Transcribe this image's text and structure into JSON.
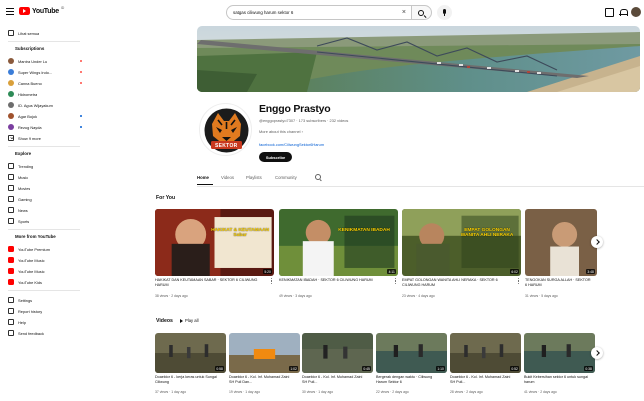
{
  "topbar": {
    "logo_text": "YouTube",
    "logo_country": "ID",
    "search_value": "satgas ciliwung harum sektor 6"
  },
  "sidebar": {
    "top_items": [
      {
        "label": "Lihat semua",
        "icon": "chevron-down-icon"
      }
    ],
    "subscriptions_heading": "Subscriptions",
    "subscriptions": [
      {
        "label": "Mantra Under Lu",
        "live": true,
        "color": "#8a5a3c"
      },
      {
        "label": "Super Wings Indo...",
        "live": true,
        "color": "#3b7dd8"
      },
      {
        "label": "Canna Bueno",
        "live": true,
        "color": "#d9a03b"
      },
      {
        "label": "Hidrometra",
        "live": false,
        "color": "#2e8b57"
      },
      {
        "label": "ID. Agus Wijayakum",
        "live": false,
        "color": "#6d6d6d"
      },
      {
        "label": "Agar Bojok",
        "live": false,
        "color": "#a0522d",
        "dot": true
      },
      {
        "label": "Rezug Nayda",
        "live": false,
        "color": "#7b3fa0",
        "dot": true
      },
      {
        "label": "Show 9 more",
        "live": false,
        "color": "",
        "chevron": true
      }
    ],
    "explore_heading": "Explore",
    "explore": [
      {
        "label": "Trending",
        "icon": "trending-icon"
      },
      {
        "label": "Music",
        "icon": "music-icon"
      },
      {
        "label": "Movies",
        "icon": "movies-icon"
      },
      {
        "label": "Gaming",
        "icon": "gaming-icon"
      },
      {
        "label": "News",
        "icon": "news-icon"
      },
      {
        "label": "Sports",
        "icon": "sports-icon"
      }
    ],
    "more_heading": "More from YouTube",
    "more": [
      {
        "label": "YouTube Premium",
        "icon": "youtube-premium-icon"
      },
      {
        "label": "YouTube Music",
        "icon": "youtube-music-icon"
      },
      {
        "label": "YouTube Music",
        "icon": "youtube-kids-icon"
      },
      {
        "label": "YouTube Kids",
        "icon": "youtube-tv-icon"
      }
    ],
    "bottom": [
      {
        "label": "Settings",
        "icon": "gear-icon"
      },
      {
        "label": "Report history",
        "icon": "flag-icon"
      },
      {
        "label": "Help",
        "icon": "help-icon"
      },
      {
        "label": "Send feedback",
        "icon": "feedback-icon"
      }
    ]
  },
  "channel": {
    "name": "Enggo Prastyo",
    "meta": "@enggoprastyo7307 · 173 subscribers · 232 videos",
    "more": "More about this channel  ›",
    "link": "facebook.com/CiliwungSektor6Harum",
    "subscribe": "Subscribe",
    "avatar_label": "SEKTOR"
  },
  "tabs": [
    "Home",
    "Videos",
    "Playlists",
    "Community"
  ],
  "for_you": {
    "title": "For You",
    "videos": [
      {
        "title": "HAKIKAT DAN KEUTAMAAN SABAR · SEKTOR 6 CILIWUNG HARUM",
        "meta": "38 views · 2 days ago",
        "duration": "5:20",
        "overlay": "HAKIKAT & KEUTAMAAN Sabar"
      },
      {
        "title": "KENIKMATAN IBADAH · SEKTOR 6 CILIWUNG HARUM",
        "meta": "49 views · 3 days ago",
        "duration": "4:11",
        "overlay": "KENIKMATAN IBADAH"
      },
      {
        "title": "EMPAT GOLONGAN WANITA AHLI NERAKA · SEKTOR 6 CILIWUNG HARUM",
        "meta": "23 views · 4 days ago",
        "duration": "6:02",
        "overlay": "EMPAT GOLONGAN WANITA AHLI NERAKA"
      },
      {
        "title": "TENGOKAN SURGA ALLAH · SEKTOR 6 HARUM",
        "meta": "31 views · 5 days ago",
        "duration": "3:48",
        "overlay": ""
      }
    ]
  },
  "videos_section": {
    "title": "Videos",
    "play_all": "Play all",
    "videos": [
      {
        "title": "Doaektor 6 - kerja keras untuk Sungai Ciliwung",
        "meta": "37 views · 1 day ago",
        "duration": "0:58"
      },
      {
        "title": "Doaektor 6 - Kol. Inf. Muhamad Zaini SH Puli Dan...",
        "meta": "19 views · 1 day ago",
        "duration": "1:02"
      },
      {
        "title": "Doaektor 6 - Kol. Inf. Muhamad Zaini SH Puli...",
        "meta": "30 views · 1 day ago",
        "duration": "0:45"
      },
      {
        "title": "Bergerak dengan waktu · Ciliwung Harum Sektor 6",
        "meta": "22 views · 2 days ago",
        "duration": "1:10"
      },
      {
        "title": "Doaektor 6 - Kol. Inf. Muhamad Zaini SH Puli...",
        "meta": "28 views · 2 days ago",
        "duration": "0:52"
      },
      {
        "title": "Bukit Kebersihan sektor 6 untuk sungai harum",
        "meta": "41 views · 2 days ago",
        "duration": "0:38"
      }
    ]
  }
}
